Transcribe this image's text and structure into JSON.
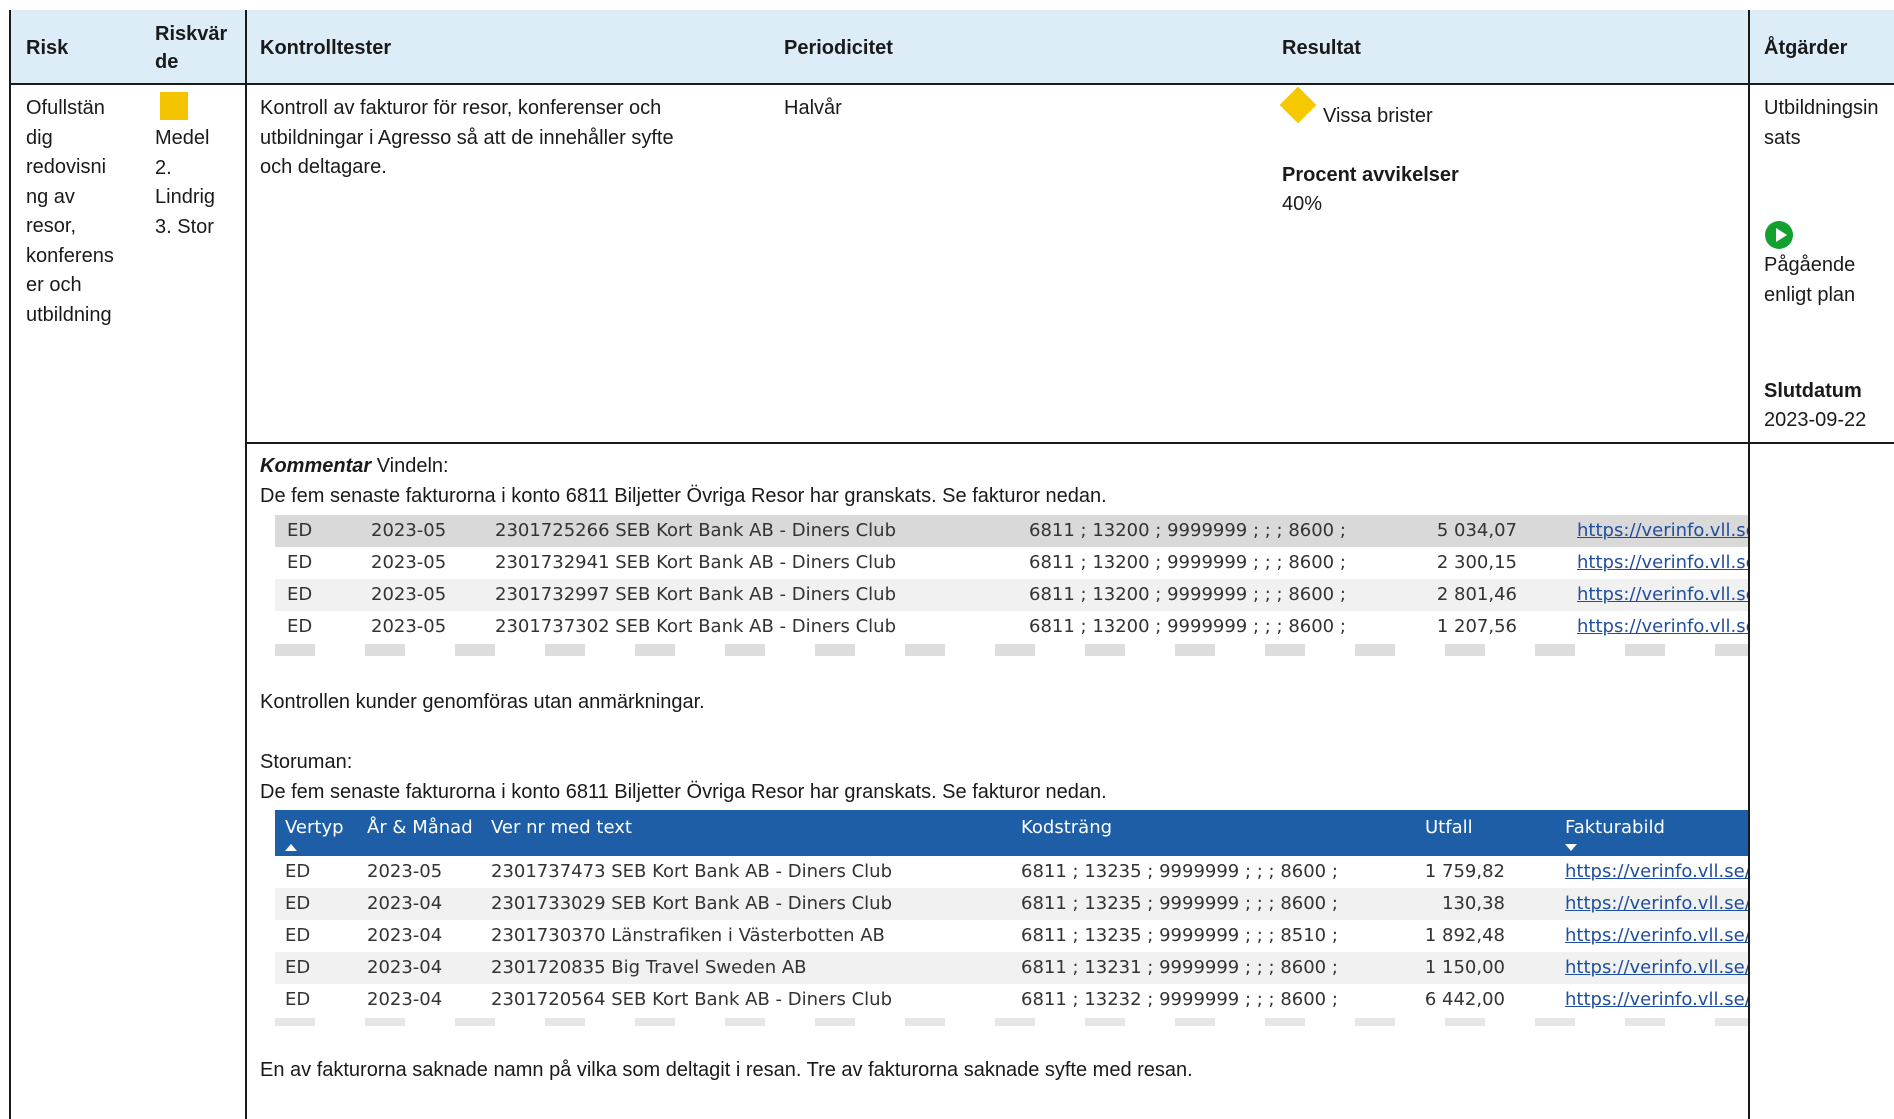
{
  "headers": {
    "risk": "Risk",
    "riskvarde_line1": "Riskvär",
    "riskvarde_line2": "de",
    "kontrolltester": "Kontrolltester",
    "periodicitet": "Periodicitet",
    "resultat": "Resultat",
    "atgarder": "Åtgärder"
  },
  "row": {
    "risk_lines": [
      "Ofullstän",
      "dig",
      "redovisni",
      "ng av",
      "resor,",
      "konferens",
      "er och",
      "utbildning"
    ],
    "riskvarde_lines": [
      "Medel",
      "2.",
      "Lindrig",
      "3. Stor"
    ],
    "kontroll_lines": [
      "Kontroll av fakturor för resor, konferenser och",
      "utbildningar i Agresso så att de innehåller syfte",
      "och deltagare."
    ],
    "periodicitet": "Halvår",
    "resultat_status": "Vissa brister",
    "procent_label": "Procent avvikelser",
    "procent_value": "40%",
    "atgard_lines": [
      "Utbildningsin",
      "sats"
    ],
    "atgard_status_lines": [
      "Pågående",
      "enligt plan"
    ],
    "slutdatum_label": "Slutdatum",
    "slutdatum_value": "2023-09-22"
  },
  "comment": {
    "label": "Kommentar",
    "vindeln_title": " Vindeln:",
    "vindeln_text": "De fem senaste fakturorna i konto 6811 Biljetter Övriga Resor har granskats. Se fakturor nedan.",
    "vindeln_conclusion": "Kontrollen kunder genomföras utan anmärkningar.",
    "storuman_title": "Storuman:",
    "storuman_text": "De fem senaste fakturorna i konto 6811 Biljetter Övriga Resor har granskats. Se fakturor nedan.",
    "storuman_conclusion": "En av fakturorna saknade namn på vilka som deltagit i resan. Tre av fakturorna saknade syfte med resan."
  },
  "vindeln_table": [
    {
      "vertyp": "ED",
      "period": "2023-05",
      "ver": "2301725266 SEB Kort Bank AB - Diners Club",
      "kod": "6811 ; 13200 ; 9999999 ; ; ; 8600 ;",
      "utfall": "5 034,07",
      "link": "https://verinfo.vll.se"
    },
    {
      "vertyp": "ED",
      "period": "2023-05",
      "ver": "2301732941 SEB Kort Bank AB - Diners Club",
      "kod": "6811 ; 13200 ; 9999999 ; ; ; 8600 ;",
      "utfall": "2 300,15",
      "link": "https://verinfo.vll.se"
    },
    {
      "vertyp": "ED",
      "period": "2023-05",
      "ver": "2301732997 SEB Kort Bank AB - Diners Club",
      "kod": "6811 ; 13200 ; 9999999 ; ; ; 8600 ;",
      "utfall": "2 801,46",
      "link": "https://verinfo.vll.se"
    },
    {
      "vertyp": "ED",
      "period": "2023-05",
      "ver": "2301737302 SEB Kort Bank AB - Diners Club",
      "kod": "6811 ; 13200 ; 9999999 ; ; ; 8600 ;",
      "utfall": "1 207,56",
      "link": "https://verinfo.vll.se"
    }
  ],
  "storuman_table": {
    "headers": {
      "vertyp": "Vertyp",
      "period": "År & Månad",
      "ver": "Ver nr med text",
      "kod": "Kodsträng",
      "utfall": "Utfall",
      "bild": "Fakturabild"
    },
    "rows": [
      {
        "vertyp": "ED",
        "period": "2023-05",
        "ver": "2301737473 SEB Kort Bank AB - Diners Club",
        "kod": "6811 ; 13235 ; 9999999 ; ; ; 8600 ;",
        "utfall": "1 759,82",
        "link": "https://verinfo.vll.se/"
      },
      {
        "vertyp": "ED",
        "period": "2023-04",
        "ver": "2301733029 SEB Kort Bank AB - Diners Club",
        "kod": "6811 ; 13235 ; 9999999 ; ; ; 8600 ;",
        "utfall": "130,38",
        "link": "https://verinfo.vll.se/"
      },
      {
        "vertyp": "ED",
        "period": "2023-04",
        "ver": "2301730370 Länstrafiken i Västerbotten AB",
        "kod": "6811 ; 13235 ; 9999999 ; ; ; 8510 ;",
        "utfall": "1 892,48",
        "link": "https://verinfo.vll.se/"
      },
      {
        "vertyp": "ED",
        "period": "2023-04",
        "ver": "2301720835 Big Travel Sweden AB",
        "kod": "6811 ; 13231 ; 9999999 ; ; ; 8600 ;",
        "utfall": "1 150,00",
        "link": "https://verinfo.vll.se/"
      },
      {
        "vertyp": "ED",
        "period": "2023-04",
        "ver": "2301720564 SEB Kort Bank AB - Diners Club",
        "kod": "6811 ; 13232 ; 9999999 ; ; ; 8600 ;",
        "utfall": "6 442,00",
        "link": "https://verinfo.vll.se/"
      }
    ]
  },
  "colors": {
    "header_bg": "#dcedf8",
    "table_header_bg": "#1d5ea6",
    "link": "#1f4e9c",
    "status_yellow": "#f5c800",
    "status_green": "#12a12e"
  }
}
